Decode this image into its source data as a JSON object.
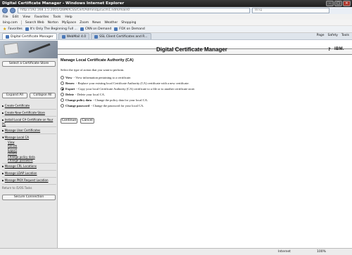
{
  "window": {
    "title": "Digital Certificate Manager - Windows Internet Explorer"
  },
  "addressbar": {
    "url": "http://192.168.1.5:2001/QIBM/ICSS/Cert/Admin/qycucm1.ndm/main0",
    "search_placeholder": "Bing"
  },
  "menu": [
    "File",
    "Edit",
    "View",
    "Favorites",
    "Tools",
    "Help"
  ],
  "linksbar": [
    "bing.com",
    "Search Web",
    "Norton",
    "MySpace",
    "Zoom",
    "News",
    "Weather",
    "Shopping"
  ],
  "favorites": {
    "label": "Favorites",
    "items": [
      "It's Only The Beginning Full ...",
      "CNN on Demand",
      "FOX on Demand"
    ]
  },
  "tabs": [
    "Digital Certificate Manager",
    "WebMail 4.0",
    "SSL Client Certificates and R..."
  ],
  "tab_tools": [
    "Page",
    "Safety",
    "Tools"
  ],
  "header": {
    "title": "Digital Certificate Manager",
    "help": "?",
    "brand": "IBM."
  },
  "sidebar": {
    "select_store": "Select a Certificate Store",
    "expand_all": "Expand All",
    "collapse_all": "Collapse All",
    "nav": [
      "Create Certificate",
      "Create New Certificate Store",
      "Install Local CA Certificate on Your PC",
      "Manage User Certificates",
      "Manage Local CA"
    ],
    "sub": [
      "View",
      "Renew",
      "Export",
      "Delete",
      "Change policy data",
      "Change password"
    ],
    "nav2": [
      "Manage CRL Locations",
      "Manage LDAP Location",
      "Manage PKIX Request Location"
    ],
    "return": "Return to i5/OS Tasks",
    "secure": "Secure Connection"
  },
  "main": {
    "title": "Manage Local Certificate Authority (CA)",
    "intro": "Select the type of action that you want to perform.",
    "options": [
      {
        "name": "View",
        "desc": " - View information pertaining to a certificate.",
        "selected": false
      },
      {
        "name": "Renew",
        "desc": " - Replace your existing local Certificate Authority (CA) certificate with a new certificate.",
        "selected": false
      },
      {
        "name": "Export",
        "desc": " - Copy your local Certificate Authority (CA) certificate to a file or to another certificate store.",
        "selected": true
      },
      {
        "name": "Delete",
        "desc": " - Delete your local CA.",
        "selected": false
      },
      {
        "name": "Change policy data",
        "desc": " - Change the policy data for your local CA.",
        "selected": false
      },
      {
        "name": "Change password",
        "desc": " - Change the password for your local CA.",
        "selected": false
      }
    ],
    "continue": "Continue",
    "cancel": "Cancel"
  },
  "status": {
    "zone": "Internet",
    "zoom": "100%"
  }
}
